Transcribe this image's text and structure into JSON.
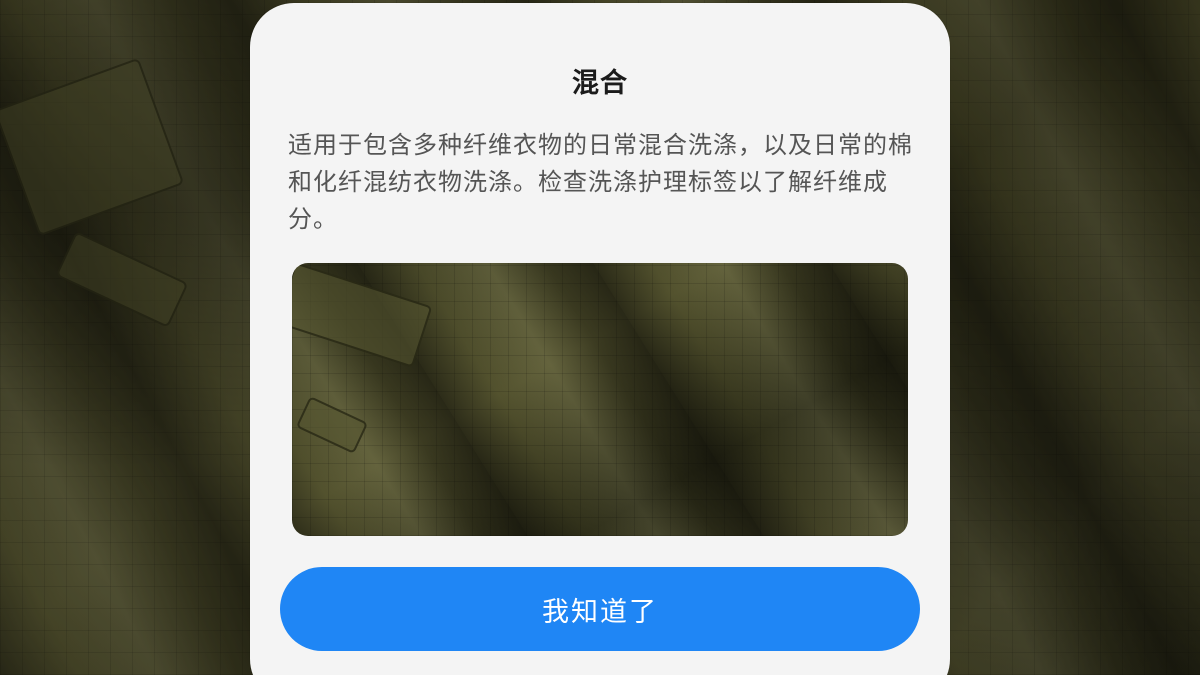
{
  "dialog": {
    "title": "混合",
    "description": "适用于包含多种纤维衣物的日常混合洗涤，以及日常的棉和化纤混纺衣物洗涤。检查洗涤护理标签以了解纤维成分。",
    "confirm_label": "我知道了"
  },
  "colors": {
    "accent": "#1f86f5",
    "dialog_background": "#f4f4f4",
    "fabric": "#4f4e2c"
  },
  "images": {
    "background": "olive ripstop fabric",
    "preview": "olive ripstop fabric close-up"
  }
}
